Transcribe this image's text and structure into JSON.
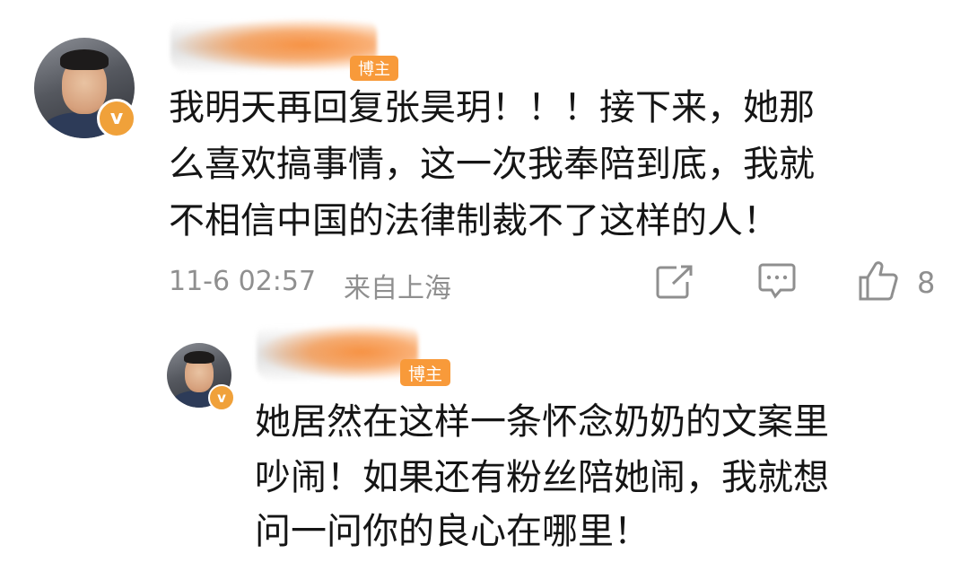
{
  "comment": {
    "badge": "博主",
    "text_lines": [
      "我明天再回复张昊玥！！！接下来，她那",
      "么喜欢搞事情，这一次我奉陪到底，我就",
      "不相信中国的法律制裁不了这样的人！"
    ],
    "timestamp": "11-6 02:57",
    "location": "来自上海",
    "like_count": "8",
    "avatar_badge": "v"
  },
  "reply": {
    "badge": "博主",
    "text_lines": [
      "她居然在这样一条怀念奶奶的文案里",
      "吵闹！如果还有粉丝陪她闹，我就想",
      "问一问你的良心在哪里！"
    ],
    "avatar_badge": "v"
  },
  "colors": {
    "brand_orange": "#f89a3a",
    "meta_gray": "#8f8f8f",
    "text": "#151515"
  },
  "icons": [
    "share-icon",
    "comment-icon",
    "like-icon"
  ]
}
